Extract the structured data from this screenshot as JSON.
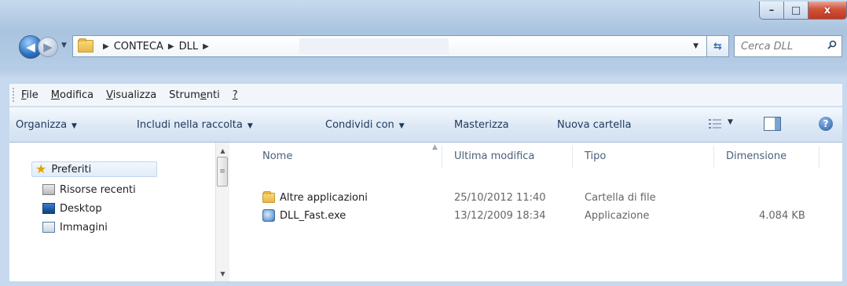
{
  "window": {
    "caption": {
      "minimize": "–",
      "maximize": "□",
      "close": "x"
    }
  },
  "address": {
    "crumbs": [
      "CONTECA",
      "DLL"
    ],
    "search_placeholder": "Cerca DLL"
  },
  "menu": [
    {
      "id": "file",
      "pre": "",
      "u": "F",
      "post": "ile"
    },
    {
      "id": "modifica",
      "pre": "",
      "u": "M",
      "post": "odifica"
    },
    {
      "id": "visualizza",
      "pre": "",
      "u": "V",
      "post": "isualizza"
    },
    {
      "id": "strumenti",
      "pre": "Strum",
      "u": "e",
      "post": "nti"
    },
    {
      "id": "help",
      "pre": "",
      "u": "?",
      "post": ""
    }
  ],
  "commands": {
    "organizza": "Organizza",
    "includi": "Includi nella raccolta",
    "condividi": "Condividi con",
    "masterizza": "Masterizza",
    "nuova_cartella": "Nuova cartella"
  },
  "navigation": {
    "preferiti": "Preferiti",
    "items": [
      "Risorse recenti",
      "Desktop",
      "Immagini"
    ]
  },
  "columns": {
    "nome": "Nome",
    "ultima_modifica": "Ultima modifica",
    "tipo": "Tipo",
    "dimensione": "Dimensione"
  },
  "files": [
    {
      "name": "Altre applicazioni",
      "modified": "25/10/2012 11:40",
      "type": "Cartella di file",
      "size": "",
      "icon": "folder-icon"
    },
    {
      "name": "DLL_Fast.exe",
      "modified": "13/12/2009 18:34",
      "type": "Applicazione",
      "size": "4.084 KB",
      "icon": "application-icon"
    }
  ],
  "colors": {
    "accent": "#1e395b",
    "close": "#c2371f"
  }
}
